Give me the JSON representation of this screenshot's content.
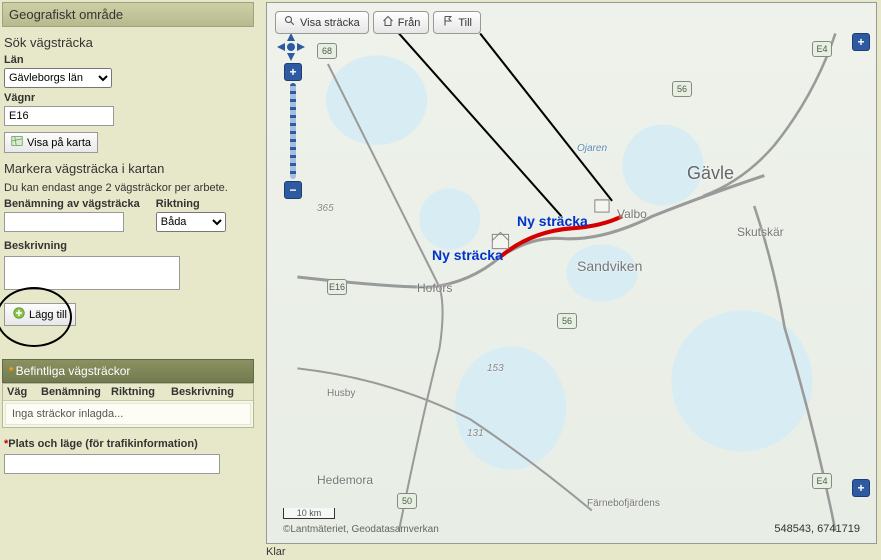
{
  "left": {
    "header": "Geografiskt område",
    "search_title": "Sök vägsträcka",
    "lan_label": "Län",
    "lan_value": "Gävleborgs län",
    "vagnr_label": "Vägnr",
    "vagnr_value": "E16",
    "show_map_btn": "Visa på karta",
    "mark_title": "Markera vägsträcka i kartan",
    "mark_note": "Du kan endast ange 2 vägsträckor per arbete.",
    "benamn_label": "Benämning av vägsträcka",
    "benamn_value": "",
    "riktning_label": "Riktning",
    "riktning_value": "Båda",
    "beskriv_label": "Beskrivning",
    "beskriv_value": "",
    "add_btn": "Lägg till",
    "table_header": "Befintliga vägsträckor",
    "th_vag": "Väg",
    "th_ben": "Benämning",
    "th_rik": "Riktning",
    "th_bes": "Beskrivning",
    "empty_row": "Inga sträckor inlagda...",
    "plats_label": "Plats och läge (för trafikinformation)",
    "plats_value": ""
  },
  "map": {
    "btn_visa": "Visa sträcka",
    "btn_fran": "Från",
    "btn_till": "Till",
    "labels": {
      "gavle": "Gävle",
      "valbo": "Valbo",
      "sandviken": "Sandviken",
      "hofors": "Hofors",
      "skutskar": "Skutskär",
      "husby": "Husby",
      "hedemora": "Hedemora",
      "farneb": "Färnebofjärdens",
      "ojaren": "Ojaren",
      "n365": "365",
      "n153": "153",
      "n131": "131"
    },
    "ny_label": "Ny sträcka",
    "scalebar": "10 km",
    "attribution": "©Lantmäteriet, Geodatasamverkan",
    "coords": "548543, 6741719",
    "shields": [
      "E4",
      "E4",
      "E16",
      "50",
      "56",
      "56",
      "68"
    ]
  },
  "status": "Klar"
}
